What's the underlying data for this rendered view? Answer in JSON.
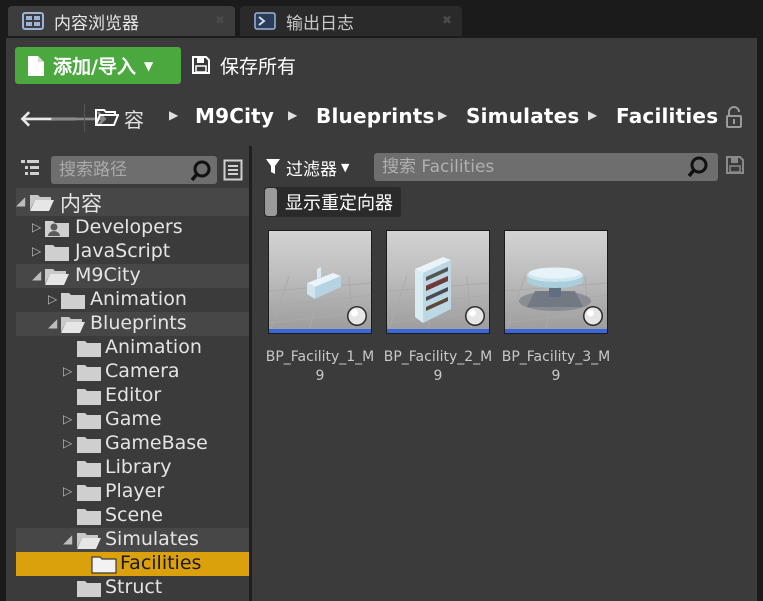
{
  "tabs": [
    {
      "label": "内容浏览器",
      "icon": "content-browser-icon",
      "active": true
    },
    {
      "label": "输出日志",
      "icon": "output-log-icon",
      "active": false
    }
  ],
  "toolbar": {
    "add_import_label": "添加/导入",
    "save_all_label": "保存所有"
  },
  "breadcrumb": {
    "items": [
      "容",
      "M9City",
      "Blueprints",
      "Simulates",
      "Facilities"
    ]
  },
  "tree": {
    "search_placeholder": "搜索路径",
    "items": [
      {
        "label": "内容",
        "depth": 0,
        "expanded": true,
        "icon": "folder-open-icon"
      },
      {
        "label": "Developers",
        "depth": 1,
        "expanded": false,
        "icon": "developers-folder-icon"
      },
      {
        "label": "JavaScript",
        "depth": 1,
        "expanded": false,
        "icon": "folder-icon"
      },
      {
        "label": "M9City",
        "depth": 1,
        "expanded": true,
        "icon": "folder-open-icon"
      },
      {
        "label": "Animation",
        "depth": 2,
        "expanded": false,
        "icon": "folder-icon"
      },
      {
        "label": "Blueprints",
        "depth": 2,
        "expanded": true,
        "icon": "folder-open-icon"
      },
      {
        "label": "Animation",
        "depth": 3,
        "icon": "folder-icon"
      },
      {
        "label": "Camera",
        "depth": 3,
        "expanded": false,
        "icon": "folder-icon"
      },
      {
        "label": "Editor",
        "depth": 3,
        "icon": "folder-icon"
      },
      {
        "label": "Game",
        "depth": 3,
        "expanded": false,
        "icon": "folder-icon"
      },
      {
        "label": "GameBase",
        "depth": 3,
        "expanded": false,
        "icon": "folder-icon"
      },
      {
        "label": "Library",
        "depth": 3,
        "icon": "folder-icon"
      },
      {
        "label": "Player",
        "depth": 3,
        "expanded": false,
        "icon": "folder-icon"
      },
      {
        "label": "Scene",
        "depth": 3,
        "icon": "folder-icon"
      },
      {
        "label": "Simulates",
        "depth": 3,
        "expanded": true,
        "icon": "folder-open-icon"
      },
      {
        "label": "Facilities",
        "depth": 4,
        "selected": true,
        "icon": "folder-icon"
      },
      {
        "label": "Struct",
        "depth": 3,
        "icon": "folder-icon"
      }
    ]
  },
  "content": {
    "filter_label": "过滤器",
    "search_placeholder": "搜索 Facilities",
    "show_redirectors_label": "显示重定向器",
    "assets": [
      {
        "name": "BP_Facility_1_M9",
        "thumbnail": "bench-thumbnail"
      },
      {
        "name": "BP_Facility_2_M9",
        "thumbnail": "shelf-thumbnail"
      },
      {
        "name": "BP_Facility_3_M9",
        "thumbnail": "round-table-thumbnail"
      }
    ]
  },
  "colors": {
    "add_button": "#4aa83e",
    "selection": "#dba10d",
    "thumbnail_bar": "#3a67d6",
    "panel_bg": "#3b3b3b"
  }
}
